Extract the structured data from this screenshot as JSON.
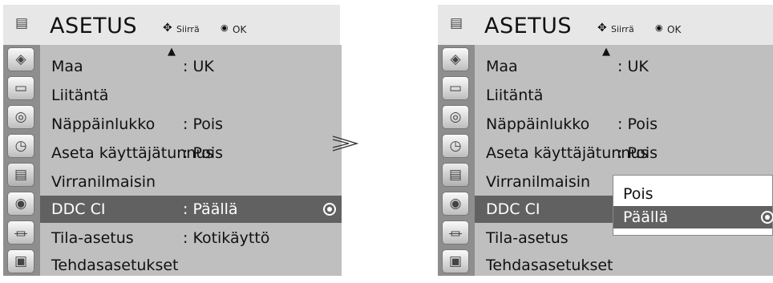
{
  "menu": {
    "title": "ASETUS",
    "hint_move": "Siirrä",
    "hint_ok": "OK",
    "move_icon": "four-way-arrow-icon",
    "ok_icon": "ok-dot-icon",
    "scroll_up_icon": "triangle-up-icon",
    "sidebar_icons": [
      "satellite-dish-icon",
      "monitor-icon",
      "speaker-icon",
      "clock-icon",
      "setup-box-icon",
      "lock-icon",
      "input-plug-icon",
      "picture-frame-icon"
    ],
    "active_sidebar_index": 4
  },
  "left_panel": {
    "items": [
      {
        "label": "Maa",
        "value": ": UK"
      },
      {
        "label": "Liitäntä",
        "value": ""
      },
      {
        "label": "Näppäinlukko",
        "value": ": Pois"
      },
      {
        "label": "Aseta käyttäjätunnus",
        "value": ": Pois"
      },
      {
        "label": "Virranilmaisin",
        "value": ""
      },
      {
        "label": "DDC CI",
        "value": ": Päällä",
        "selected": true
      },
      {
        "label": "Tila-asetus",
        "value": ": Kotikäyttö"
      },
      {
        "label": "Tehdasasetukset",
        "value": ""
      }
    ]
  },
  "right_panel": {
    "items": [
      {
        "label": "Maa",
        "value": ": UK"
      },
      {
        "label": "Liitäntä",
        "value": ""
      },
      {
        "label": "Näppäinlukko",
        "value": ": Pois"
      },
      {
        "label": "Aseta käyttäjätunnus",
        "value": ": Pois"
      },
      {
        "label": "Virranilmaisin",
        "value": ""
      },
      {
        "label": "DDC CI",
        "value": "",
        "selected": true
      },
      {
        "label": "Tila-asetus",
        "value": ""
      },
      {
        "label": "Tehdasasetukset",
        "value": ""
      }
    ],
    "popup": {
      "options": [
        {
          "label": "Pois",
          "selected": false
        },
        {
          "label": "Päällä",
          "selected": true
        }
      ]
    }
  },
  "transition_icon": "next-step-arrow-icon",
  "colors": {
    "header_bg": "#e7e7e7",
    "list_bg": "#bfbfbf",
    "sidebar_bg": "#8e8e8e",
    "selected_bg": "#616161"
  }
}
